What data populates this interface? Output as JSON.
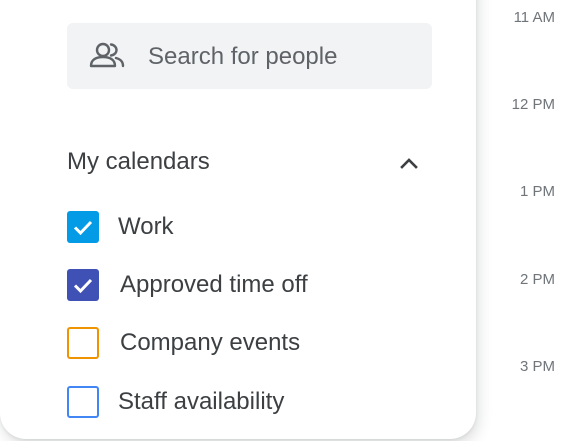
{
  "search": {
    "placeholder": "Search for people",
    "icon": "people-icon"
  },
  "my_calendars": {
    "title": "My calendars",
    "toggle_icon": "chevron-up-icon",
    "items": [
      {
        "label": "Work",
        "checked": true,
        "color": "#039be5"
      },
      {
        "label": "Approved time off",
        "checked": true,
        "color": "#3f51b5"
      },
      {
        "label": "Company events",
        "checked": false,
        "color": "#f09300"
      },
      {
        "label": "Staff availability",
        "checked": false,
        "color": "#4285f4"
      }
    ]
  },
  "timeline": {
    "hours": [
      "11 AM",
      "12 PM",
      "1 PM",
      "2 PM",
      "3 PM"
    ]
  }
}
